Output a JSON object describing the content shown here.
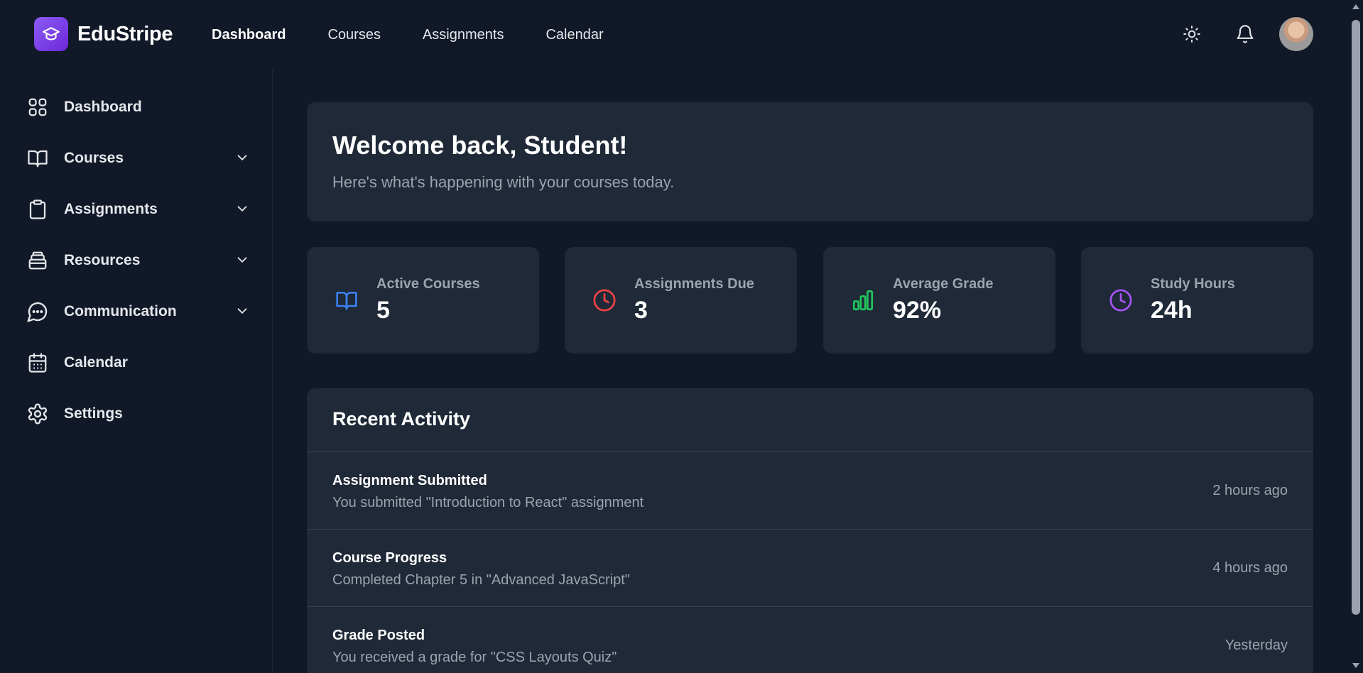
{
  "app": {
    "name": "EduStripe"
  },
  "topnav": {
    "items": [
      {
        "label": "Dashboard",
        "active": true
      },
      {
        "label": "Courses"
      },
      {
        "label": "Assignments"
      },
      {
        "label": "Calendar"
      }
    ]
  },
  "header_actions": {
    "theme_icon": "sun-icon",
    "notifications_icon": "bell-icon",
    "avatar": "user-avatar"
  },
  "sidebar": {
    "items": [
      {
        "label": "Dashboard",
        "icon": "grid-icon",
        "expandable": false
      },
      {
        "label": "Courses",
        "icon": "book-open-icon",
        "expandable": true
      },
      {
        "label": "Assignments",
        "icon": "clipboard-icon",
        "expandable": true
      },
      {
        "label": "Resources",
        "icon": "archive-icon",
        "expandable": true
      },
      {
        "label": "Communication",
        "icon": "chat-icon",
        "expandable": true
      },
      {
        "label": "Calendar",
        "icon": "calendar-icon",
        "expandable": false
      },
      {
        "label": "Settings",
        "icon": "gear-icon",
        "expandable": false
      }
    ]
  },
  "welcome": {
    "title": "Welcome back, Student!",
    "subtitle": "Here's what's happening with your courses today."
  },
  "stats": [
    {
      "label": "Active Courses",
      "value": "5",
      "icon": "book-open-icon",
      "color": "#3b82f6"
    },
    {
      "label": "Assignments Due",
      "value": "3",
      "icon": "clock-icon",
      "color": "#ef4444"
    },
    {
      "label": "Average Grade",
      "value": "92%",
      "icon": "bar-chart-icon",
      "color": "#22c55e"
    },
    {
      "label": "Study Hours",
      "value": "24h",
      "icon": "clock-icon",
      "color": "#a855f7"
    }
  ],
  "activity": {
    "title": "Recent Activity",
    "items": [
      {
        "title": "Assignment Submitted",
        "desc": "You submitted \"Introduction to React\" assignment",
        "time": "2 hours ago"
      },
      {
        "title": "Course Progress",
        "desc": "Completed Chapter 5 in \"Advanced JavaScript\"",
        "time": "4 hours ago"
      },
      {
        "title": "Grade Posted",
        "desc": "You received a grade for \"CSS Layouts Quiz\"",
        "time": "Yesterday"
      }
    ]
  },
  "colors": {
    "background": "#111827",
    "card": "#1f2937",
    "brand": "#7c3aed"
  }
}
